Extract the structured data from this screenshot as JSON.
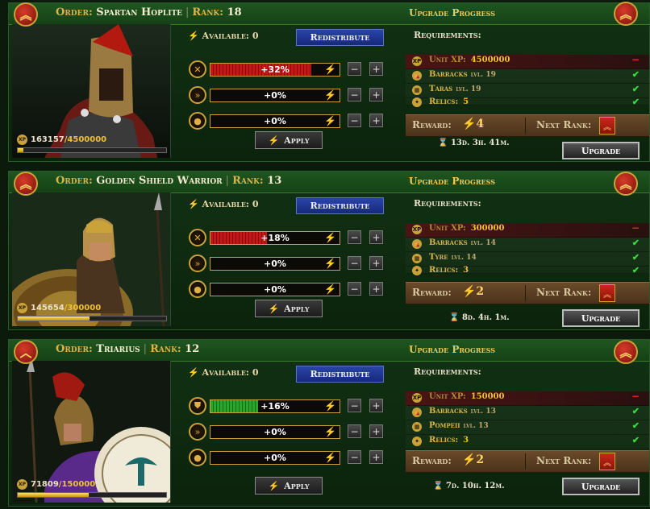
{
  "common": {
    "order_label": "Order:",
    "rank_label": "Rank:",
    "upgrade_progress": "Upgrade Progress",
    "available_label": "Available: 0",
    "redistribute": "Redistribute",
    "apply": "Apply",
    "requirements": "Requirements:",
    "reward_label": "Reward:",
    "next_rank_label": "Next Rank:",
    "upgrade": "Upgrade",
    "plus": "+",
    "minus": "−",
    "xp": "XP",
    "colors": {
      "accent_gold": "#e8c95a",
      "bar_red": "#c41818",
      "bar_green": "#2aa52a",
      "check_green": "#3adb3a",
      "button_blue": "#2a45a8"
    }
  },
  "units": [
    {
      "name": "Spartan Hoplite",
      "rank": "18",
      "xp_current": "163157",
      "xp_max": "/4500000",
      "xp_fraction": 0.036,
      "stats": [
        {
          "icon": "crossed-swords-icon",
          "value": "+32%",
          "fill": 0.78,
          "color": "red"
        },
        {
          "icon": "double-chevron-icon",
          "value": "+0%",
          "fill": 0,
          "color": "red"
        },
        {
          "icon": "money-bag-icon",
          "value": "+0%",
          "fill": 0,
          "color": "red"
        }
      ],
      "requirements": [
        {
          "icon": "xp-icon",
          "name": "Unit XP:",
          "level_label": "",
          "value": "4500000",
          "met": false
        },
        {
          "icon": "barracks-icon",
          "name": "Barracks",
          "level_label": "lvl. 19",
          "value": "",
          "met": true
        },
        {
          "icon": "city-icon",
          "name": "Taras",
          "level_label": "lvl. 19",
          "value": "",
          "met": true
        },
        {
          "icon": "relic-icon",
          "name": "Relics:",
          "level_label": "",
          "value": "5",
          "met": true
        }
      ],
      "reward": "⚡4",
      "time": "13d. 3h. 41m."
    },
    {
      "name": "Golden Shield Warrior",
      "rank": "13",
      "xp_current": "145654",
      "xp_max": "/300000",
      "xp_fraction": 0.485,
      "stats": [
        {
          "icon": "crossed-swords-icon",
          "value": "+18%",
          "fill": 0.44,
          "color": "red"
        },
        {
          "icon": "double-chevron-icon",
          "value": "+0%",
          "fill": 0,
          "color": "red"
        },
        {
          "icon": "money-bag-icon",
          "value": "+0%",
          "fill": 0,
          "color": "red"
        }
      ],
      "requirements": [
        {
          "icon": "xp-icon",
          "name": "Unit XP:",
          "level_label": "",
          "value": "300000",
          "met": false
        },
        {
          "icon": "barracks-icon",
          "name": "Barracks",
          "level_label": "lvl. 14",
          "value": "",
          "met": true
        },
        {
          "icon": "city-icon",
          "name": "Tyre",
          "level_label": "lvl. 14",
          "value": "",
          "met": true
        },
        {
          "icon": "relic-icon",
          "name": "Relics:",
          "level_label": "",
          "value": "3",
          "met": true
        }
      ],
      "reward": "⚡2",
      "time": "8d. 4h. 1m."
    },
    {
      "name": "Triarius",
      "rank": "12",
      "xp_current": "71809",
      "xp_max": "/150000",
      "xp_fraction": 0.479,
      "stats": [
        {
          "icon": "shield-icon",
          "value": "+16%",
          "fill": 0.37,
          "color": "green"
        },
        {
          "icon": "double-chevron-icon",
          "value": "+0%",
          "fill": 0,
          "color": "red"
        },
        {
          "icon": "money-bag-icon",
          "value": "+0%",
          "fill": 0,
          "color": "red"
        }
      ],
      "requirements": [
        {
          "icon": "xp-icon",
          "name": "Unit XP:",
          "level_label": "",
          "value": "150000",
          "met": false
        },
        {
          "icon": "barracks-icon",
          "name": "Barracks",
          "level_label": "lvl. 13",
          "value": "",
          "met": true
        },
        {
          "icon": "city-icon",
          "name": "Pompeii",
          "level_label": "lvl. 13",
          "value": "",
          "met": true
        },
        {
          "icon": "relic-icon",
          "name": "Relics:",
          "level_label": "",
          "value": "3",
          "met": true
        }
      ],
      "reward": "⚡2",
      "time": "7d. 10h. 12m."
    }
  ]
}
